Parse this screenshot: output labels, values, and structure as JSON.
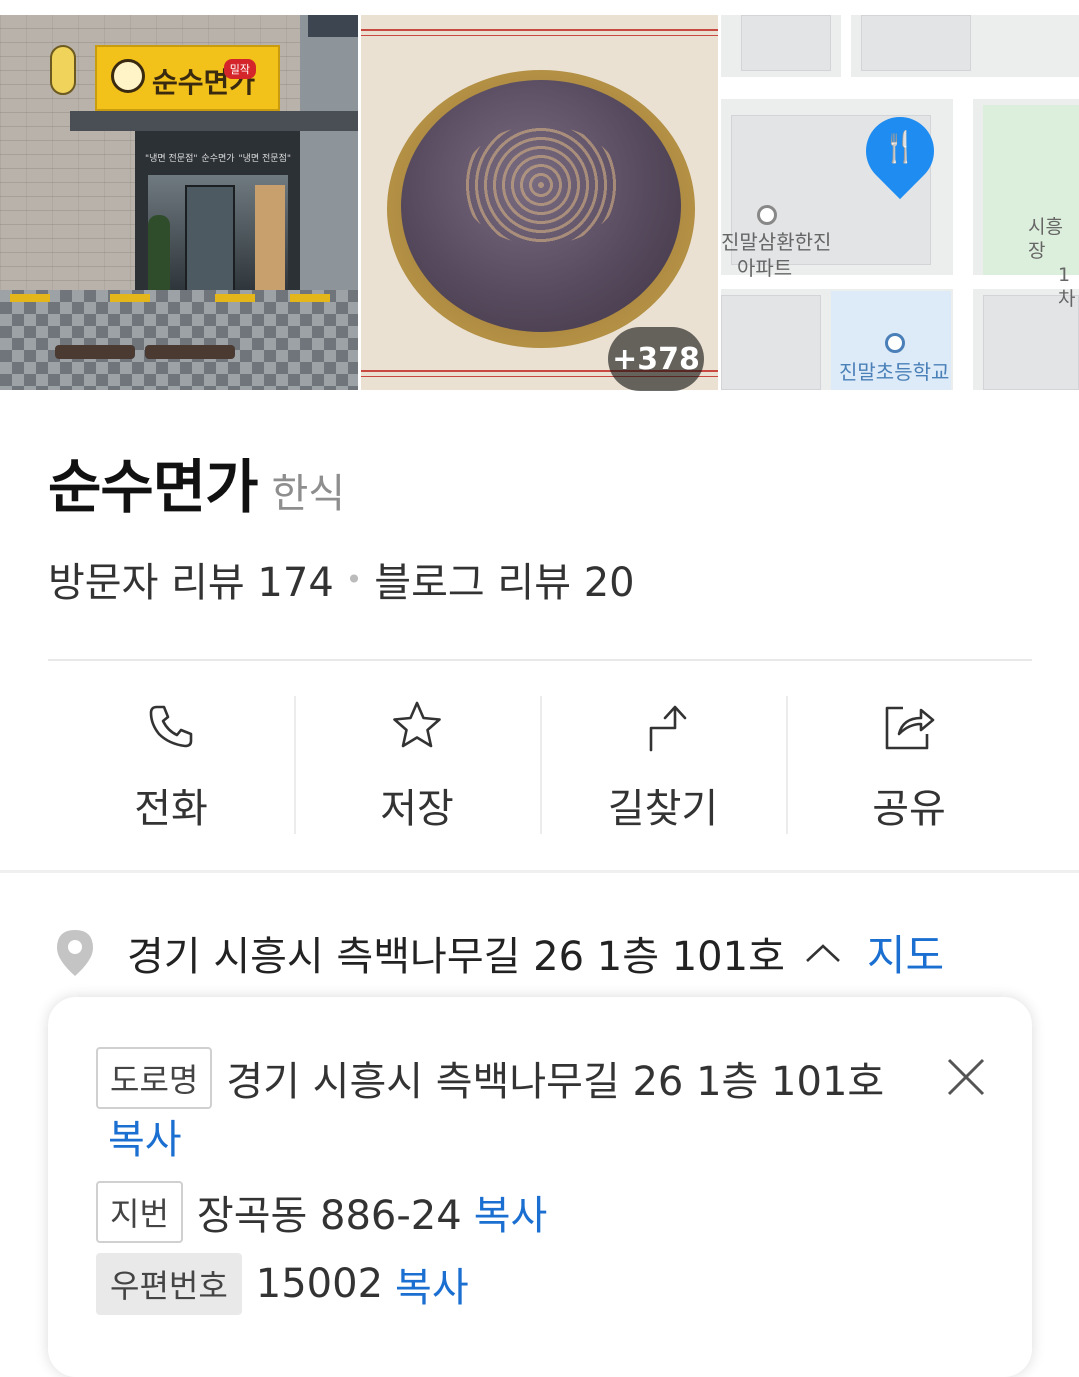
{
  "photos": {
    "storefront_sign": "순수면가",
    "storefront_sign_badge": "밀작",
    "storefront_window_left": "\"냉면 전문점\"",
    "storefront_window_mid": "순수면가",
    "storefront_window_right": "\"냉면 전문점\"",
    "more_count": "+378"
  },
  "map_thumb": {
    "apartment_label_1": "진말삼환한진",
    "apartment_label_2": "아파트",
    "school_label": "진말초등학교",
    "edge_label_1": "시흥장",
    "edge_label_2": "1차",
    "pin_icon": "restaurant-icon",
    "pin_color": "#1e8cf0"
  },
  "place": {
    "name": "순수면가",
    "category": "한식",
    "visitor_reviews": "방문자 리뷰 174",
    "separator": "•",
    "blog_reviews": "블로그 리뷰 20"
  },
  "actions": [
    {
      "label": "전화",
      "icon": "phone-icon"
    },
    {
      "label": "저장",
      "icon": "star-icon"
    },
    {
      "label": "길찾기",
      "icon": "directions-icon"
    },
    {
      "label": "공유",
      "icon": "share-icon"
    }
  ],
  "address": {
    "text": "경기 시흥시 측백나무길 26 1층 101호",
    "map_link": "지도"
  },
  "popup": {
    "road_tag": "도로명",
    "road_value": "경기 시흥시 측백나무길 26 1층 101호",
    "road_copy": "복사",
    "lot_tag": "지번",
    "lot_value": "장곡동 886-24",
    "lot_copy": "복사",
    "zip_tag": "우편번호",
    "zip_value": "15002",
    "zip_copy": "복사"
  },
  "colors": {
    "link": "#1a6fd1",
    "pin": "#1e8cf0"
  }
}
